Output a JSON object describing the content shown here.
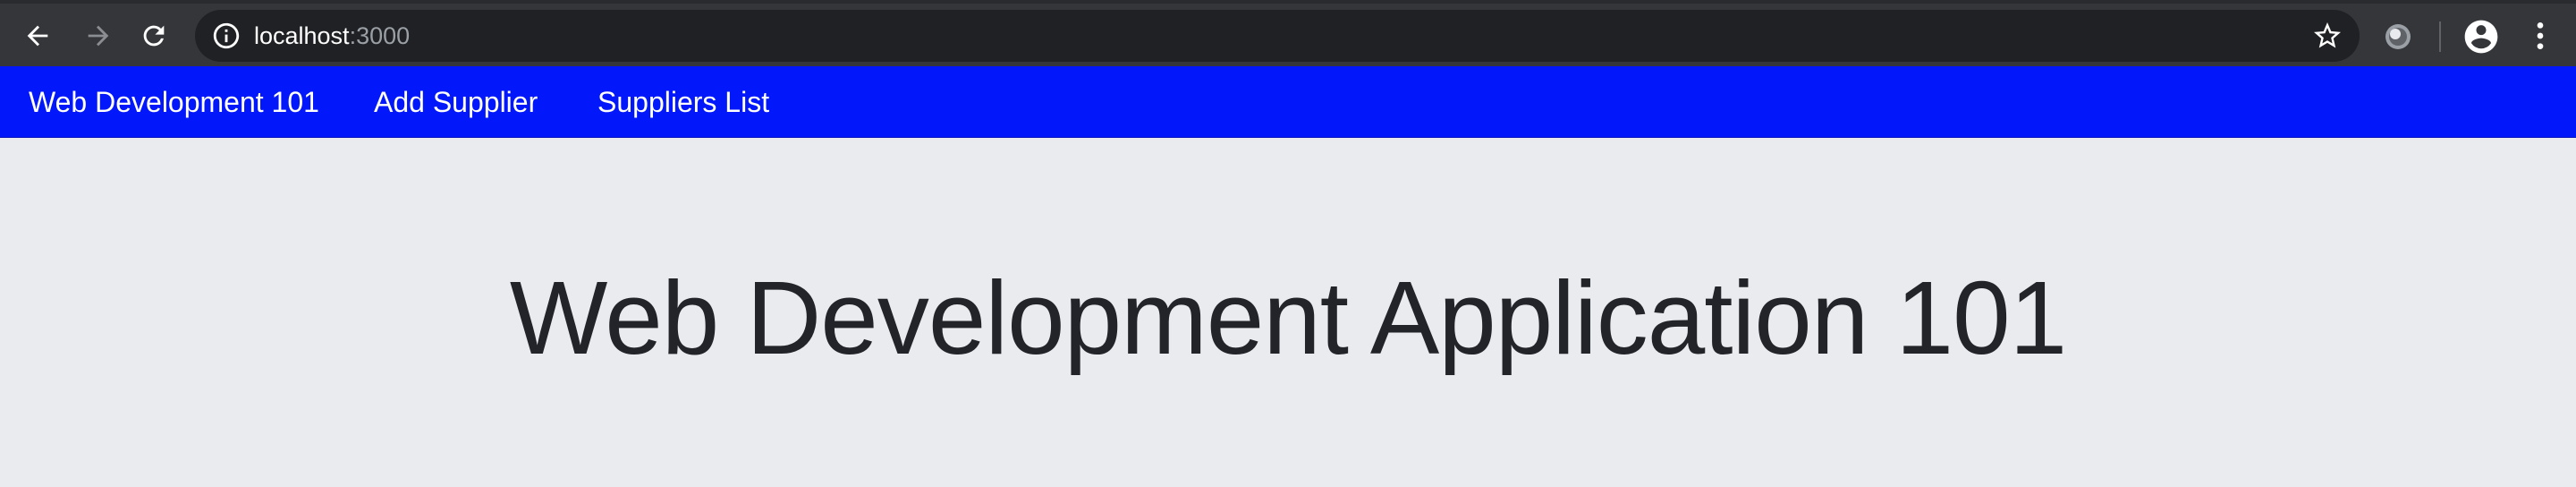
{
  "browser": {
    "url_host": "localhost",
    "url_port": ":3000",
    "icons": {
      "back": "arrow-left-icon",
      "forward": "arrow-right-icon",
      "reload": "reload-icon",
      "info": "info-icon",
      "bookmark": "star-icon",
      "extension": "extension-icon",
      "profile": "account-circle-icon",
      "menu": "more-vert-icon"
    }
  },
  "navbar": {
    "brand": "Web Development 101",
    "links": [
      {
        "label": "Add Supplier"
      },
      {
        "label": "Suppliers List"
      }
    ],
    "background": "#0318fa"
  },
  "main": {
    "title": "Web Development Application 101"
  },
  "colors": {
    "toolbar": "#35363a",
    "omnibox": "#202124",
    "page_background": "#e9ebef",
    "title_text": "#222429"
  }
}
